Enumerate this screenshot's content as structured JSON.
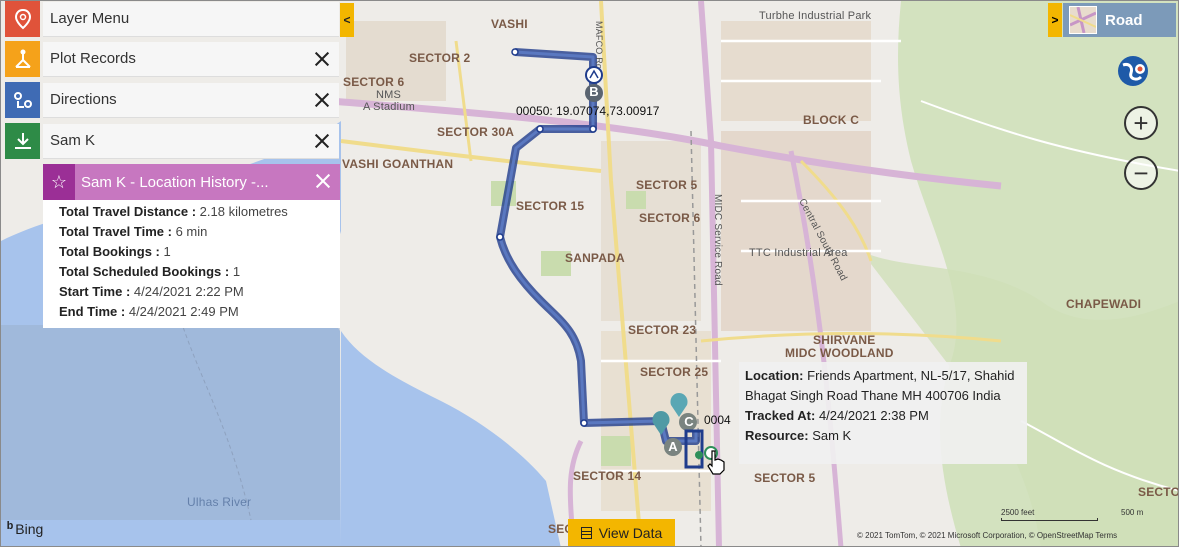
{
  "left_panel": {
    "layer_menu": "Layer Menu",
    "plot_records": "Plot Records",
    "directions": "Directions",
    "resource": "Sam K",
    "history_title": "Sam K - Location History -...",
    "stats": [
      {
        "label": "Total Travel Distance :",
        "value": "2.18 kilometres"
      },
      {
        "label": "Total Travel Time :",
        "value": "6 min"
      },
      {
        "label": "Total Bookings :",
        "value": "1"
      },
      {
        "label": "Total Scheduled Bookings :",
        "value": "1"
      },
      {
        "label": "Start Time :",
        "value": "4/24/2021 2:22 PM"
      },
      {
        "label": "End Time :",
        "value": "4/24/2021 2:49 PM"
      }
    ]
  },
  "map_style": {
    "label": "Road"
  },
  "view_data": "View Data",
  "bing": "Bing",
  "attribution": "© 2021 TomTom, © 2021 Microsoft Corporation, © OpenStreetMap  Terms",
  "scale": {
    "feet": "2500 feet",
    "meters": "500 m"
  },
  "markers": {
    "b": {
      "letter": "B",
      "coords": "00050: 19.07074,73.00917"
    },
    "c": {
      "letter": "C",
      "coords": "0004"
    },
    "a": {
      "letter": "A"
    }
  },
  "tooltip": {
    "location_label": "Location:",
    "location_value": "Friends Apartment, NL-5/17, Shahid Bhagat Singh Road Thane MH 400706 India",
    "tracked_label": "Tracked At:",
    "tracked_value": "4/24/2021 2:38 PM",
    "resource_label": "Resource:",
    "resource_value": "Sam K"
  },
  "map_labels": {
    "vashi": "VASHI",
    "sector2": "SECTOR 2",
    "sector6a": "SECTOR 6",
    "nms1": "NMS",
    "nms2": "A Stadium",
    "sector30a": "SECTOR 30A",
    "vashi_goanthan": "VASHI GOANTHAN",
    "sector15": "SECTOR 15",
    "sanpada": "SANPADA",
    "sector5a": "SECTOR 5",
    "sector6b": "SECTOR 6",
    "sector23": "SECTOR 23",
    "sector25": "SECTOR 25",
    "sector14": "SECTOR 14",
    "sector5b": "SECTOR 5",
    "block_c": "BLOCK C",
    "turbhe": "Turbhe Industrial Park",
    "ttc": "TTC Industrial Area",
    "chapewadi": "CHAPEWADI",
    "shirvane": "SHIRVANE",
    "midc": "MIDC WOODLAND",
    "sector_r": "SECTO",
    "sec": "SEC",
    "ulhas": "Ulhas River",
    "csr": "Central South Road",
    "midc_road": "MIDC Service Road",
    "mafco": "MAFCO Road"
  }
}
